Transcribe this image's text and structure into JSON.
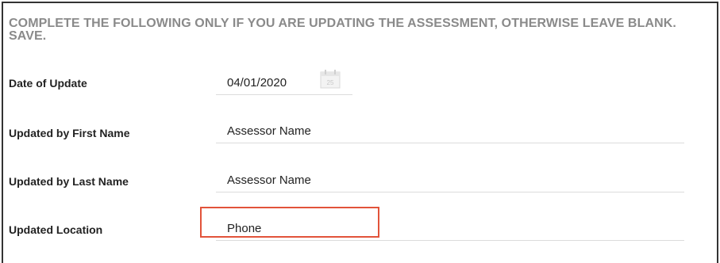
{
  "form": {
    "heading": "COMPLETE THE FOLLOWING ONLY IF YOU ARE UPDATING THE ASSESSMENT, OTHERWISE LEAVE BLANK. SAVE.",
    "date_of_update": {
      "label": "Date of Update",
      "value": "04/01/2020",
      "calendar_icon": "calendar-icon",
      "calendar_day": "25"
    },
    "first_name": {
      "label": "Updated by First Name",
      "value": "Assessor Name"
    },
    "last_name": {
      "label": "Updated by Last Name",
      "value": "Assessor Name"
    },
    "location": {
      "label": "Updated Location",
      "value": "Phone"
    }
  },
  "colors": {
    "heading": "#8a8a8a",
    "highlight": "#e2533a",
    "border": "#333333",
    "field_underline": "#dcdcdc"
  }
}
